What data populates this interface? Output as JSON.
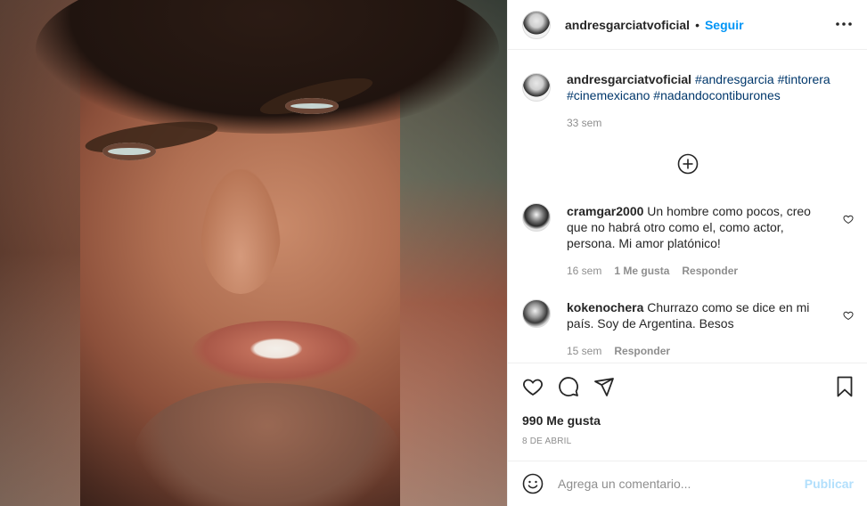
{
  "post": {
    "image_alt": "",
    "author": "andresgarciatvoficial",
    "follow_label": "Seguir",
    "separator": "•",
    "more_label": "•••"
  },
  "caption": {
    "author": "andresgarciatvoficial",
    "hashtags": [
      "#andresgarcia",
      "#tintorera",
      "#cinemexicano",
      "#nadandocontiburones"
    ],
    "time": "33 sem"
  },
  "comments": [
    {
      "user": "cramgar2000",
      "text": "Un hombre como pocos, creo que no habrá otro como el, como actor, persona. Mi amor platónico!",
      "time": "16 sem",
      "likes": "1 Me gusta",
      "reply": "Responder"
    },
    {
      "user": "kokenochera",
      "text": "Churrazo como se dice en mi país. Soy de Argentina. Besos",
      "time": "15 sem",
      "reply": "Responder"
    }
  ],
  "stats": {
    "likes": "990 Me gusta",
    "date": "8 DE ABRIL"
  },
  "composer": {
    "placeholder": "Agrega un comentario...",
    "publish": "Publicar"
  },
  "icons": [
    "heart-icon",
    "comment-icon",
    "share-icon",
    "bookmark-icon",
    "emoji-icon",
    "plus-circle-icon",
    "more-icon"
  ],
  "colors": {
    "accent": "#0095f6",
    "hashtag": "#00376b",
    "muted": "#8e8e8e",
    "publish_disabled": "#b2dffc"
  }
}
